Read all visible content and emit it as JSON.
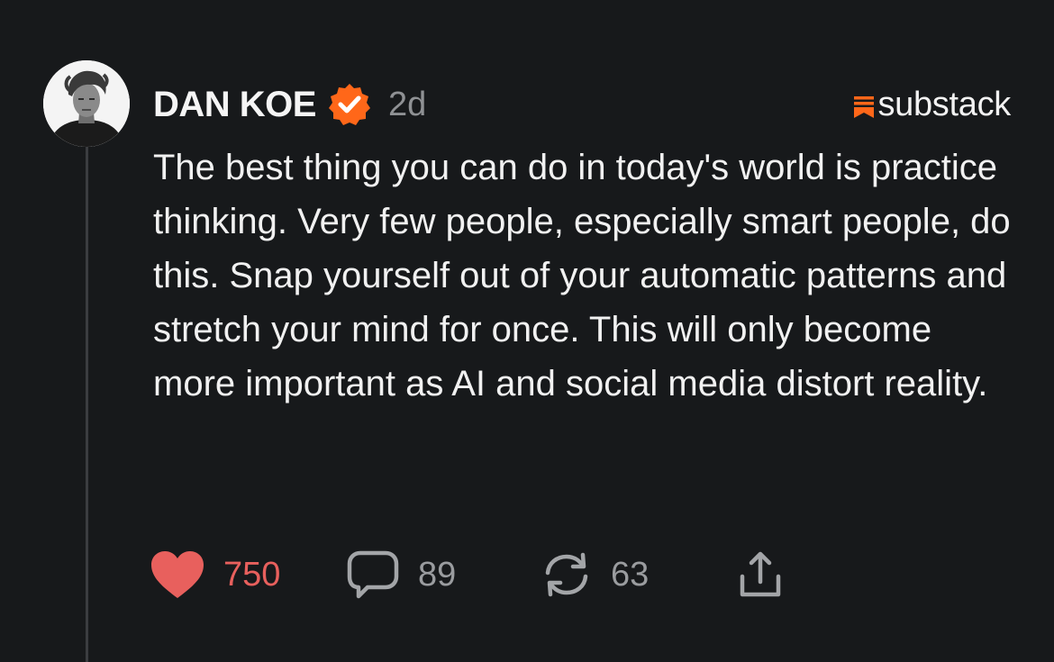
{
  "post": {
    "author": "DAN KOE",
    "timestamp": "2d",
    "brand": "substack",
    "body": "The best thing you can do in today's world is practice thinking. Very few people, especially smart people, do this. Snap yourself out of your automatic patterns and stretch your mind for once. This will only become more important as AI and social media distort reality.",
    "actions": {
      "likes": "750",
      "comments": "89",
      "restacks": "63"
    }
  },
  "icons": {
    "verified": "verified-badge-icon",
    "brand_mark": "substack-logo-icon",
    "like": "heart-icon",
    "comment": "speech-bubble-icon",
    "restack": "refresh-arrows-icon",
    "share": "share-upload-icon"
  },
  "colors": {
    "background": "#17191b",
    "accent_orange": "#ff6719",
    "like_red": "#e8605d",
    "muted_text": "#8f9194"
  }
}
